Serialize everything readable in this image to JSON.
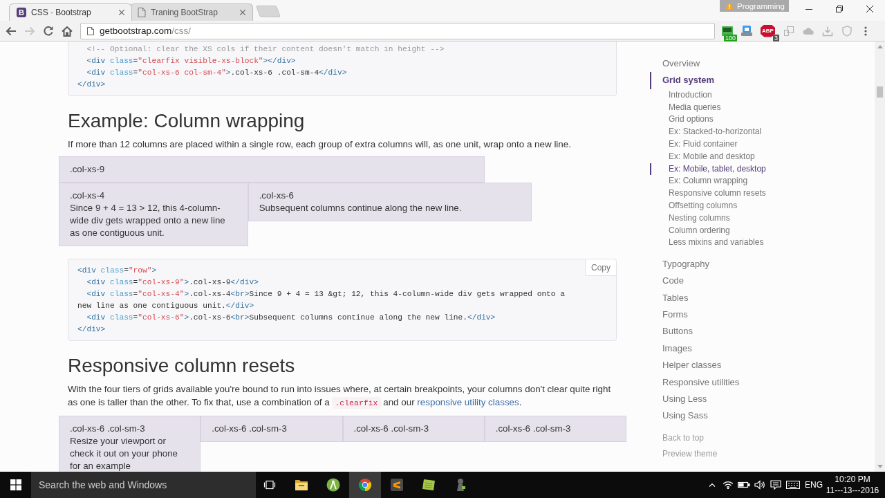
{
  "browser": {
    "tabs": [
      {
        "title": "CSS · Bootstrap",
        "selected": true,
        "icon_letter": "B"
      },
      {
        "title": "Traning BootStrap",
        "selected": false
      }
    ],
    "profile_badge": "Programming",
    "nav_buttons": [
      {
        "kind": "back",
        "disabled": false
      },
      {
        "kind": "forward",
        "disabled": true
      },
      {
        "kind": "reload",
        "disabled": false
      },
      {
        "kind": "home",
        "disabled": false
      }
    ],
    "address": {
      "host": "getbootstrap.com",
      "path": "/css/"
    },
    "extensions": [
      {
        "kind": "meter",
        "badge": "100",
        "disabled": false
      },
      {
        "kind": "tile",
        "disabled": false
      },
      {
        "kind": "stop",
        "label": "ABP",
        "badge": "3",
        "disabled": false
      },
      {
        "kind": "pages",
        "disabled": true
      },
      {
        "kind": "cloud",
        "disabled": true
      },
      {
        "kind": "download",
        "disabled": true
      },
      {
        "kind": "shield",
        "disabled": true
      }
    ]
  },
  "page": {
    "blocks": [
      {
        "kind": "code",
        "lines": [
          [
            {
              "kind": "comment",
              "text": "  <!-- Optional: clear the XS cols if their content doesn't match in height -->"
            }
          ],
          [
            {
              "kind": "tag",
              "text": "  <div "
            },
            {
              "kind": "attr",
              "text": "class"
            },
            {
              "kind": "plain",
              "text": "="
            },
            {
              "kind": "string",
              "text": "\"clearfix visible-xs-block\""
            },
            {
              "kind": "tag",
              "text": "></div>"
            }
          ],
          [
            {
              "kind": "tag",
              "text": "  <div "
            },
            {
              "kind": "attr",
              "text": "class"
            },
            {
              "kind": "plain",
              "text": "="
            },
            {
              "kind": "string",
              "text": "\"col-xs-6 col-sm-4\""
            },
            {
              "kind": "tag",
              "text": ">"
            },
            {
              "kind": "plain",
              "text": ".col-xs-6 .col-sm-4"
            },
            {
              "kind": "tag",
              "text": "</div>"
            }
          ],
          [
            {
              "kind": "tag",
              "text": "</div>"
            }
          ]
        ]
      },
      {
        "kind": "heading",
        "text": "Example: Column wrapping"
      },
      {
        "kind": "paragraph",
        "parts": [
          {
            "kind": "text",
            "text": "If more than 12 columns are placed within a single row, each group of extra columns will, as one unit, wrap onto a new line."
          }
        ]
      },
      {
        "kind": "grid",
        "rows": [
          [
            {
              "label": ".col-xs-9"
            }
          ],
          [
            {
              "label": ".col-xs-4",
              "text": "Since 9 + 4 = 13 > 12, this 4-column-wide div gets wrapped onto a new line as one contiguous unit."
            },
            {
              "label": ".col-xs-6",
              "text": "Subsequent columns continue along the new line."
            }
          ]
        ]
      },
      {
        "kind": "code",
        "copy_button": "Copy",
        "lines": [
          [
            {
              "kind": "tag",
              "text": "<div "
            },
            {
              "kind": "attr",
              "text": "class"
            },
            {
              "kind": "plain",
              "text": "="
            },
            {
              "kind": "string",
              "text": "\"row\""
            },
            {
              "kind": "tag",
              "text": ">"
            }
          ],
          [
            {
              "kind": "tag",
              "text": "  <div "
            },
            {
              "kind": "attr",
              "text": "class"
            },
            {
              "kind": "plain",
              "text": "="
            },
            {
              "kind": "string",
              "text": "\"col-xs-9\""
            },
            {
              "kind": "tag",
              "text": ">"
            },
            {
              "kind": "plain",
              "text": ".col-xs-9"
            },
            {
              "kind": "tag",
              "text": "</div>"
            }
          ],
          [
            {
              "kind": "tag",
              "text": "  <div "
            },
            {
              "kind": "attr",
              "text": "class"
            },
            {
              "kind": "plain",
              "text": "="
            },
            {
              "kind": "string",
              "text": "\"col-xs-4\""
            },
            {
              "kind": "tag",
              "text": ">"
            },
            {
              "kind": "plain",
              "text": ".col-xs-4"
            },
            {
              "kind": "tag",
              "text": "<br>"
            },
            {
              "kind": "plain",
              "text": "Since 9 + 4 = 13 &gt; 12, this 4-column-wide div gets wrapped onto a"
            }
          ],
          [
            {
              "kind": "plain",
              "text": "new line as one contiguous unit."
            },
            {
              "kind": "tag",
              "text": "</div>"
            }
          ],
          [
            {
              "kind": "tag",
              "text": "  <div "
            },
            {
              "kind": "attr",
              "text": "class"
            },
            {
              "kind": "plain",
              "text": "="
            },
            {
              "kind": "string",
              "text": "\"col-xs-6\""
            },
            {
              "kind": "tag",
              "text": ">"
            },
            {
              "kind": "plain",
              "text": ".col-xs-6"
            },
            {
              "kind": "tag",
              "text": "<br>"
            },
            {
              "kind": "plain",
              "text": "Subsequent columns continue along the new line."
            },
            {
              "kind": "tag",
              "text": "</div>"
            }
          ],
          [
            {
              "kind": "tag",
              "text": "</div>"
            }
          ]
        ]
      },
      {
        "kind": "heading",
        "text": "Responsive column resets"
      },
      {
        "kind": "paragraph",
        "parts": [
          {
            "kind": "text",
            "text": "With the four tiers of grids available you're bound to run into issues where, at certain breakpoints, your columns don't clear quite right as one is taller than the other. To fix that, use a combination of a "
          },
          {
            "kind": "code",
            "text": ".clearfix"
          },
          {
            "kind": "text",
            "text": " and our "
          },
          {
            "kind": "link",
            "text": "responsive utility classes"
          },
          {
            "kind": "text",
            "text": "."
          }
        ]
      },
      {
        "kind": "grid",
        "rows": [
          [
            {
              "label": ".col-xs-6 .col-sm-3",
              "text": "Resize your viewport or check it out on your phone for an example"
            },
            {
              "label": ".col-xs-6 .col-sm-3"
            },
            {
              "label": ".col-xs-6 .col-sm-3"
            },
            {
              "label": ".col-xs-6 .col-sm-3"
            }
          ]
        ]
      }
    ]
  },
  "sidebar": {
    "items": [
      {
        "label": "Overview",
        "selected": false
      },
      {
        "label": "Grid system",
        "selected": true,
        "children": [
          {
            "label": "Introduction",
            "selected": false
          },
          {
            "label": "Media queries",
            "selected": false
          },
          {
            "label": "Grid options",
            "selected": false
          },
          {
            "label": "Ex: Stacked-to-horizontal",
            "selected": false
          },
          {
            "label": "Ex: Fluid container",
            "selected": false
          },
          {
            "label": "Ex: Mobile and desktop",
            "selected": false
          },
          {
            "label": "Ex: Mobile, tablet, desktop",
            "selected": true
          },
          {
            "label": "Ex: Column wrapping",
            "selected": false
          },
          {
            "label": "Responsive column resets",
            "selected": false
          },
          {
            "label": "Offsetting columns",
            "selected": false
          },
          {
            "label": "Nesting columns",
            "selected": false
          },
          {
            "label": "Column ordering",
            "selected": false
          },
          {
            "label": "Less mixins and variables",
            "selected": false
          }
        ]
      },
      {
        "label": "Typography",
        "selected": false
      },
      {
        "label": "Code",
        "selected": false
      },
      {
        "label": "Tables",
        "selected": false
      },
      {
        "label": "Forms",
        "selected": false
      },
      {
        "label": "Buttons",
        "selected": false
      },
      {
        "label": "Images",
        "selected": false
      },
      {
        "label": "Helper classes",
        "selected": false
      },
      {
        "label": "Responsive utilities",
        "selected": false
      },
      {
        "label": "Using Less",
        "selected": false
      },
      {
        "label": "Using Sass",
        "selected": false
      }
    ],
    "footer_links": [
      "Back to top",
      "Preview theme"
    ]
  },
  "taskbar": {
    "search_placeholder": "Search the web and Windows",
    "apps": [
      {
        "kind": "folder",
        "selected": false
      },
      {
        "kind": "compass",
        "selected": false
      },
      {
        "kind": "chrome",
        "selected": true
      },
      {
        "kind": "editor",
        "selected": false
      },
      {
        "kind": "notebook",
        "selected": false
      },
      {
        "kind": "figure",
        "selected": false
      }
    ],
    "language": "ENG",
    "time": "10:20 PM",
    "date": "11---13---2016"
  }
}
